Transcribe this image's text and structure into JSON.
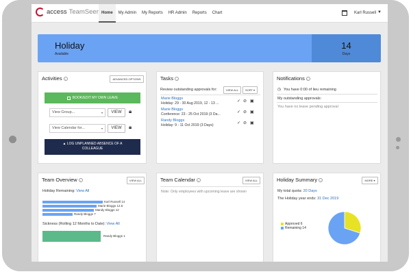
{
  "app": {
    "brand_part1": "access",
    "brand_part2": "TeamSeer"
  },
  "nav": {
    "tabs": [
      {
        "label": "Home",
        "active": true
      },
      {
        "label": "My Admin"
      },
      {
        "label": "My Reports"
      },
      {
        "label": "HR Admin"
      },
      {
        "label": "Reports"
      },
      {
        "label": "Chart"
      }
    ],
    "user_name": "Karl Russell",
    "user_caret": "▼"
  },
  "banner": {
    "title": "Holiday",
    "subtitle": "Available",
    "value": "14",
    "unit": "Days",
    "color": "#6aa3f4",
    "value_bg": "#4f8ad9"
  },
  "activities": {
    "title": "Activities",
    "advanced_options": "ADVANCED OPTIONS",
    "book_button": "BOOK/EDIT MY OWN LEAVE",
    "view_group_placeholder": "View Group...",
    "view_calendar_placeholder": "View Calendar for...",
    "view_label": "VIEW",
    "log_absence_line1": "LOG UNPLANNED ABSENCE OF A",
    "log_absence_line2": "COLLEAGUE",
    "book_color": "#5cb85c",
    "log_color": "#1f2b4d"
  },
  "tasks": {
    "title": "Tasks",
    "review_label": "Review outstanding approvals for:",
    "view_all": "VIEW ALL",
    "sort": "SORT",
    "items": [
      {
        "name": "Marie Bloggs",
        "detail": "Holiday: 29 - 30 Aug 2019, 12 - 13 ..."
      },
      {
        "name": "Marie Bloggs",
        "detail": "Conference: 23 - 25 Oct 2019 (3 Da..."
      },
      {
        "name": "Randy Bloggs",
        "detail": "Holiday: 9 - 11 Oct 2019 (3 Days)"
      }
    ]
  },
  "notifications": {
    "title": "Notifications",
    "lieu": "You have 0:00 of lieu remaining",
    "outstanding": "My outstanding approvals:",
    "pending": "You have no leave pending approval"
  },
  "team_overview": {
    "title": "Team Overview",
    "view_all": "VIEW ALL",
    "holiday_remaining_label": "Holiday Remaining:",
    "holiday_remaining_link": "View All",
    "holiday_bars": [
      {
        "name": "Karl Russell",
        "value": 14
      },
      {
        "name": "Marie Bloggs",
        "value": 12.5
      },
      {
        "name": "Mandy Bloggs",
        "value": 12
      },
      {
        "name": "Randy Bloggs",
        "value": 7
      }
    ],
    "sickness_label": "Sickness (Rolling 12 Months to Date):",
    "sickness_link": "View All",
    "sickness_bars": [
      {
        "name": "Randy Bloggs",
        "value": 1
      }
    ],
    "holiday_bar_color": "#6aa3f4",
    "sickness_bar_color": "#5cba8a"
  },
  "team_calendar": {
    "title": "Team Calendar",
    "view_all": "VIEW ALL",
    "note": "Note: Only employees with upcoming leave are shown"
  },
  "holiday_summary": {
    "title": "Holiday Summary",
    "more": "MORE",
    "quota_label": "My total quota:",
    "quota_value": "20 Days",
    "year_end_label": "The Holiday year ends:",
    "year_end_value": "31 Dec 2019",
    "legend": [
      {
        "label": "Approved 6",
        "color": "#e8e227"
      },
      {
        "label": "Remaining 14",
        "color": "#6aa3f4"
      }
    ]
  },
  "chart_data": {
    "type": "pie",
    "values": [
      6,
      14
    ],
    "categories": [
      "Approved",
      "Remaining"
    ],
    "colors": [
      "#e8e227",
      "#6aa3f4"
    ]
  }
}
